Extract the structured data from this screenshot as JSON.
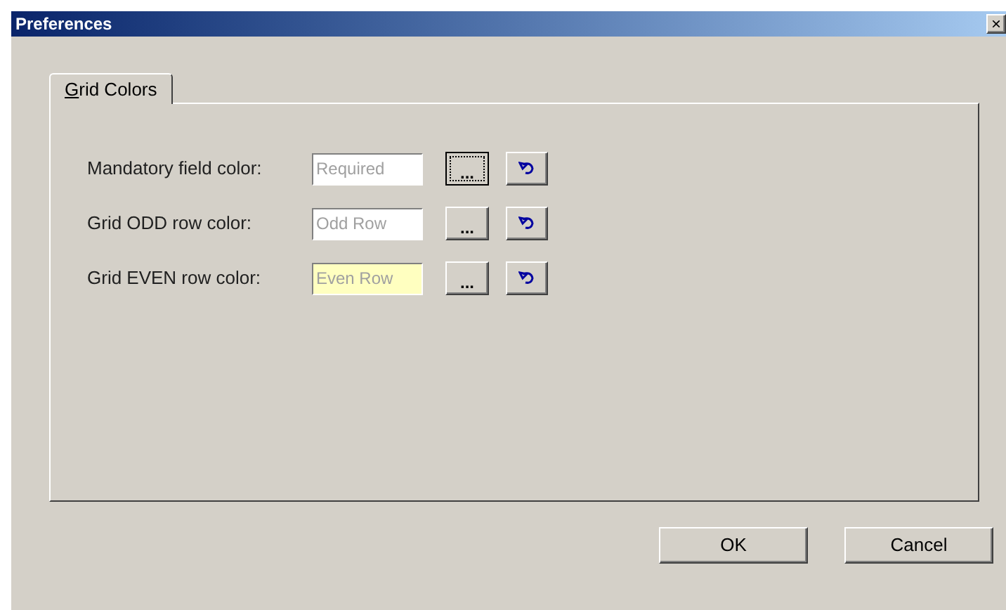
{
  "window": {
    "title": "Preferences",
    "close": "×"
  },
  "tabs": [
    {
      "label": "Grid Colors",
      "selected": true
    }
  ],
  "rows": [
    {
      "label": "Mandatory field color:",
      "placeholder": "Required",
      "color": "#ffffff",
      "button": "...",
      "focused": true
    },
    {
      "label": "Grid ODD row color:",
      "placeholder": "Odd Row",
      "color": "#ffffff",
      "button": "...",
      "focused": false
    },
    {
      "label": "Grid EVEN row color:",
      "placeholder": "Even Row",
      "color": "#ffffc0",
      "button": "...",
      "focused": false
    }
  ],
  "buttons": [
    "OK",
    "Cancel"
  ]
}
